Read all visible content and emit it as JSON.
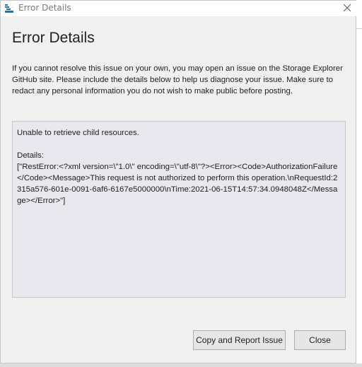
{
  "window": {
    "title": "Error Details",
    "icon": "storage-explorer-icon",
    "close_icon": "close-icon"
  },
  "dialog": {
    "heading": "Error Details",
    "description": "If you cannot resolve this issue on your own, you may open an issue on the Storage Explorer GitHub site. Please include the details below to help us diagnose your issue. Make sure to redact any personal information you do not wish to make public before posting.",
    "details_text": "Unable to retrieve child resources.\n\nDetails:\n[\"RestError:<?xml version=\\\"1.0\\\" encoding=\\\"utf-8\\\"?><Error><Code>AuthorizationFailure</Code><Message>This request is not authorized to perform this operation.\\nRequestId:2315a576-601e-0091-6af6-6167e5000000\\nTime:2021-06-15T14:57:34.0948048Z</Message></Error>\"]"
  },
  "buttons": {
    "report_label": "Copy and Report Issue",
    "close_label": "Close"
  },
  "colors": {
    "dialog_bg": "#f0f0f0",
    "details_bg": "#e8e8ee",
    "button_bg": "#e6e6e6"
  }
}
